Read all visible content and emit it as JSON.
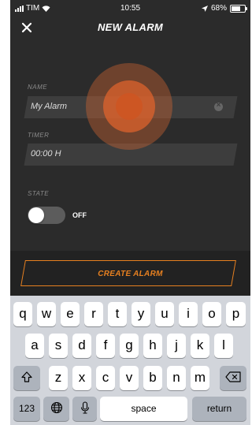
{
  "status_bar": {
    "carrier": "TIM",
    "time": "10:55",
    "battery": "68%",
    "battery_level": 0.68
  },
  "header": {
    "title": "NEW ALARM"
  },
  "form": {
    "name": {
      "label": "NAME",
      "value": "My Alarm"
    },
    "timer": {
      "label": "TIMER",
      "value": "00:00 H"
    },
    "state": {
      "label": "STATE",
      "toggle_text": "OFF",
      "on": false
    }
  },
  "create_button": {
    "label": "CREATE ALARM"
  },
  "colors": {
    "accent": "#e78020",
    "background": "#2b2b2b",
    "field": "#3d3d3d",
    "keyboard": "#d2d5db"
  },
  "keyboard": {
    "row1": [
      "q",
      "w",
      "e",
      "r",
      "t",
      "y",
      "u",
      "i",
      "o",
      "p"
    ],
    "row2": [
      "a",
      "s",
      "d",
      "f",
      "g",
      "h",
      "j",
      "k",
      "l"
    ],
    "row3": [
      "z",
      "x",
      "c",
      "v",
      "b",
      "n",
      "m"
    ],
    "numbers_key": "123",
    "space_key": "space",
    "return_key": "return"
  }
}
